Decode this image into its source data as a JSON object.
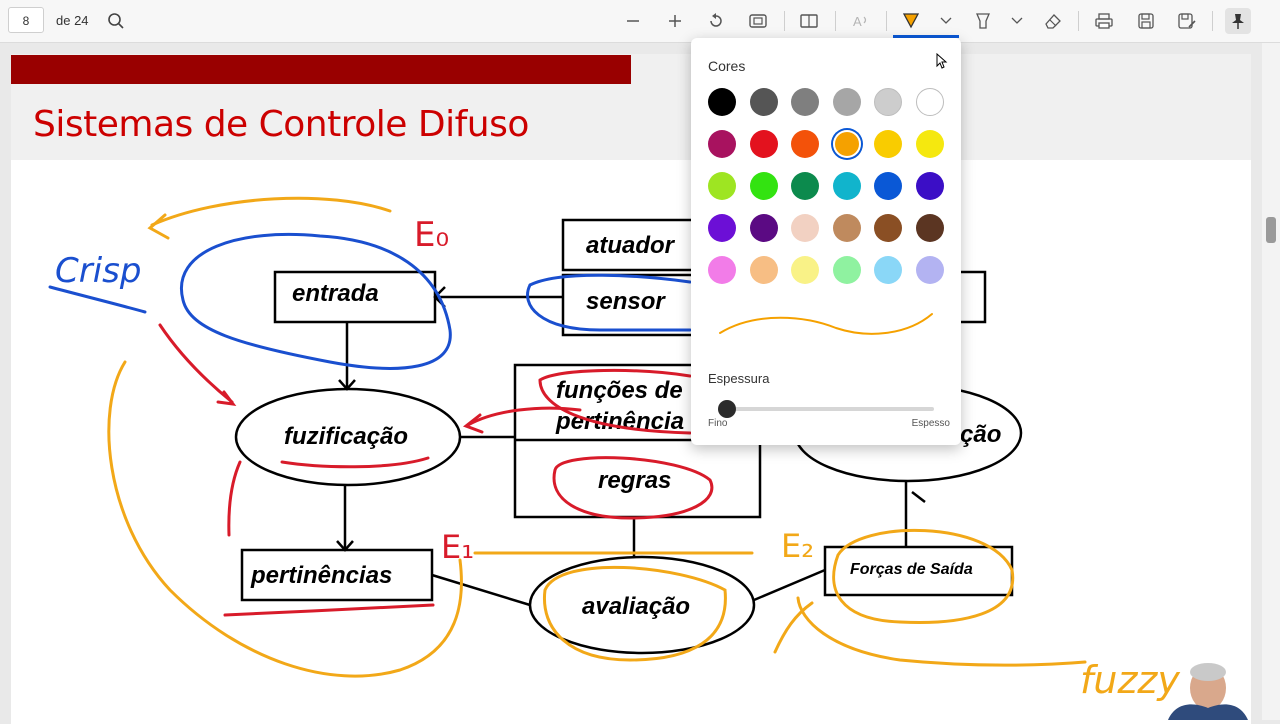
{
  "toolbar": {
    "page_current": "8",
    "page_total": "de 24",
    "icons": [
      "search-icon",
      "zoom-out-icon",
      "zoom-in-icon",
      "rotate-icon",
      "fit-page-icon",
      "page-view-icon",
      "read-aloud-icon",
      "draw-icon",
      "chevron-down-icon",
      "highlight-icon",
      "chevron-down-icon",
      "eraser-icon",
      "print-icon",
      "save-icon",
      "save-as-icon",
      "pin-icon"
    ]
  },
  "slide": {
    "title": "Sistemas de Controle Difuso",
    "boxes": {
      "entrada": "entrada",
      "atuador": "atuador",
      "sensor": "sensor",
      "fuzificacao": "fuzificação",
      "funcoes1": "funções de",
      "funcoes2": "pertinência",
      "regras": "regras",
      "pertinencias": "pertinências",
      "avaliacao": "avaliação",
      "forcas": "Forças de Saída",
      "defuz": "ção"
    },
    "handwriting": {
      "crisp": "Crisp",
      "e0": "E₀",
      "e1": "E₁",
      "e2": "E₂",
      "fuzzy": "fuzzy"
    },
    "accent_colors": {
      "title_red": "#cc0000",
      "bar_red": "#990000",
      "ink_blue": "#1a4fcf",
      "ink_red": "#d81b2a",
      "ink_orange": "#f2a818"
    }
  },
  "popup": {
    "cores_label": "Cores",
    "swatches": [
      {
        "color": "#000000",
        "name": "Preto"
      },
      {
        "color": "#555555",
        "name": "Cinza escuro"
      },
      {
        "color": "#7f7f7f",
        "name": "Cinza"
      },
      {
        "color": "#a6a6a6",
        "name": "Cinza médio"
      },
      {
        "color": "#cdcdcd",
        "name": "Cinza claro"
      },
      {
        "color": "#ffffff",
        "name": "Branco"
      },
      {
        "color": "#a8125f",
        "name": "Vinho"
      },
      {
        "color": "#e3121e",
        "name": "Vermelho"
      },
      {
        "color": "#f3520a",
        "name": "Laranja escuro"
      },
      {
        "color": "#f5a100",
        "name": "Laranja",
        "selected": true
      },
      {
        "color": "#f9cc00",
        "name": "Amarelo ouro"
      },
      {
        "color": "#f5e80f",
        "name": "Amarelo"
      },
      {
        "color": "#9ee522",
        "name": "Verde limão"
      },
      {
        "color": "#33e311",
        "name": "Verde"
      },
      {
        "color": "#0c8a4d",
        "name": "Verde escuro"
      },
      {
        "color": "#11b4cc",
        "name": "Ciano"
      },
      {
        "color": "#0a58d6",
        "name": "Azul"
      },
      {
        "color": "#3b0ec6",
        "name": "Índigo"
      },
      {
        "color": "#6c0fd6",
        "name": "Roxo"
      },
      {
        "color": "#5b0a83",
        "name": "Roxo escuro"
      },
      {
        "color": "#f2d1c2",
        "name": "Pêssego"
      },
      {
        "color": "#bf8a5e",
        "name": "Bronze"
      },
      {
        "color": "#8a4f24",
        "name": "Marrom"
      },
      {
        "color": "#5b3522",
        "name": "Marrom escuro"
      },
      {
        "color": "#f27ce8",
        "name": "Rosa"
      },
      {
        "color": "#f7be84",
        "name": "Damasco"
      },
      {
        "color": "#f9f287",
        "name": "Amarelo claro"
      },
      {
        "color": "#8ff2a0",
        "name": "Verde claro"
      },
      {
        "color": "#8ad7f7",
        "name": "Azul claro"
      },
      {
        "color": "#b3b3f2",
        "name": "Lavanda"
      }
    ],
    "selected_color": "#f5a100",
    "espessura_label": "Espessura",
    "thickness_value": 0.0,
    "slider_min": "Fino",
    "slider_max": "Espesso"
  }
}
